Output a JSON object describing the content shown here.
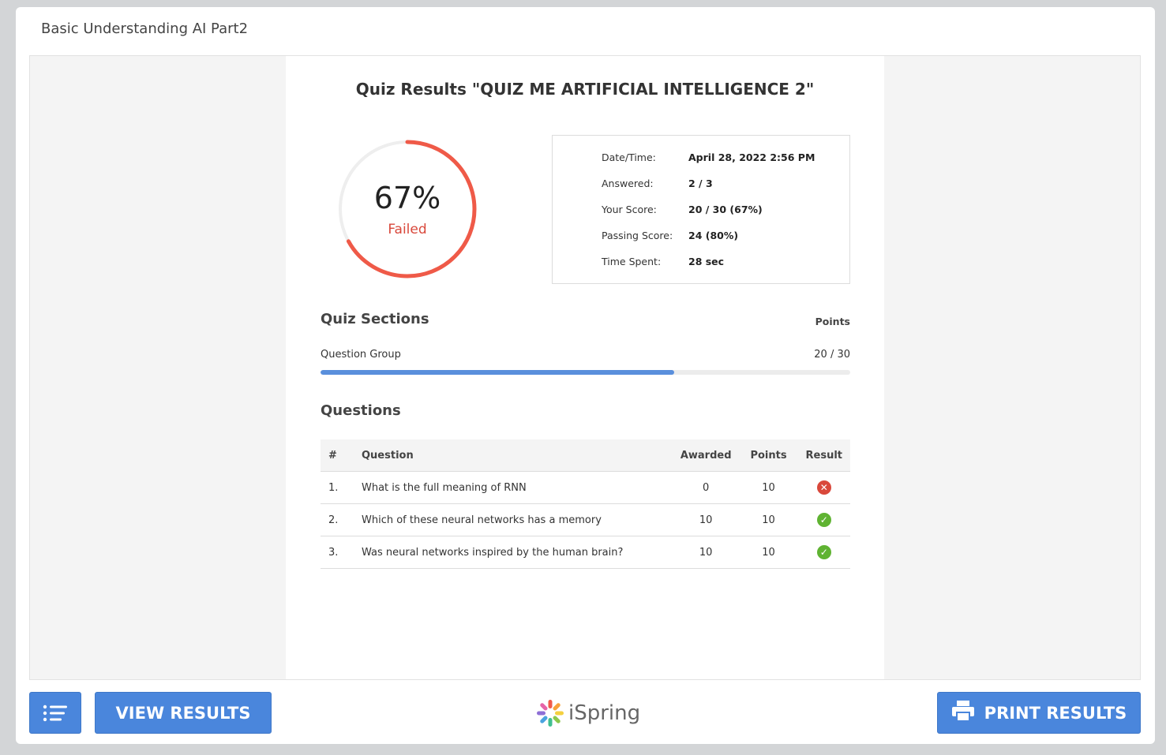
{
  "course_title": "Basic Understanding AI Part2",
  "slide": {
    "title": "Quiz Results \"QUIZ ME ARTIFICIAL INTELLIGENCE 2\"",
    "score_percent": "67%",
    "score_fraction": 0.67,
    "status": "Failed",
    "details": [
      {
        "label": "Date/Time:",
        "value": "April 28, 2022 2:56 PM"
      },
      {
        "label": "Answered:",
        "value": "2 / 3"
      },
      {
        "label": "Your Score:",
        "value": "20 / 30 (67%)"
      },
      {
        "label": "Passing Score:",
        "value": "24 (80%)"
      },
      {
        "label": "Time Spent:",
        "value": "28 sec"
      }
    ],
    "sections_heading": "Quiz Sections",
    "points_heading": "Points",
    "group": {
      "name": "Question Group",
      "score": "20 / 30",
      "fraction": 0.667
    },
    "questions_heading": "Questions",
    "table_headers": {
      "num": "#",
      "question": "Question",
      "awarded": "Awarded",
      "points": "Points",
      "result": "Result"
    },
    "questions": [
      {
        "num": "1.",
        "text": "What is the full meaning of RNN",
        "awarded": "0",
        "points": "10",
        "result": "incorrect"
      },
      {
        "num": "2.",
        "text": "Which of these neural networks has a memory",
        "awarded": "10",
        "points": "10",
        "result": "correct"
      },
      {
        "num": "3.",
        "text": "Was neural networks inspired by the human brain?",
        "awarded": "10",
        "points": "10",
        "result": "correct"
      }
    ]
  },
  "footer": {
    "menu_icon": "list-icon",
    "view_results_label": "VIEW RESULTS",
    "logo_text": "iSpring",
    "print_icon": "printer-icon",
    "print_results_label": "PRINT RESULTS"
  },
  "colors": {
    "fail": "#d9483b",
    "correct": "#5fb332",
    "accent": "#4a86dc"
  }
}
